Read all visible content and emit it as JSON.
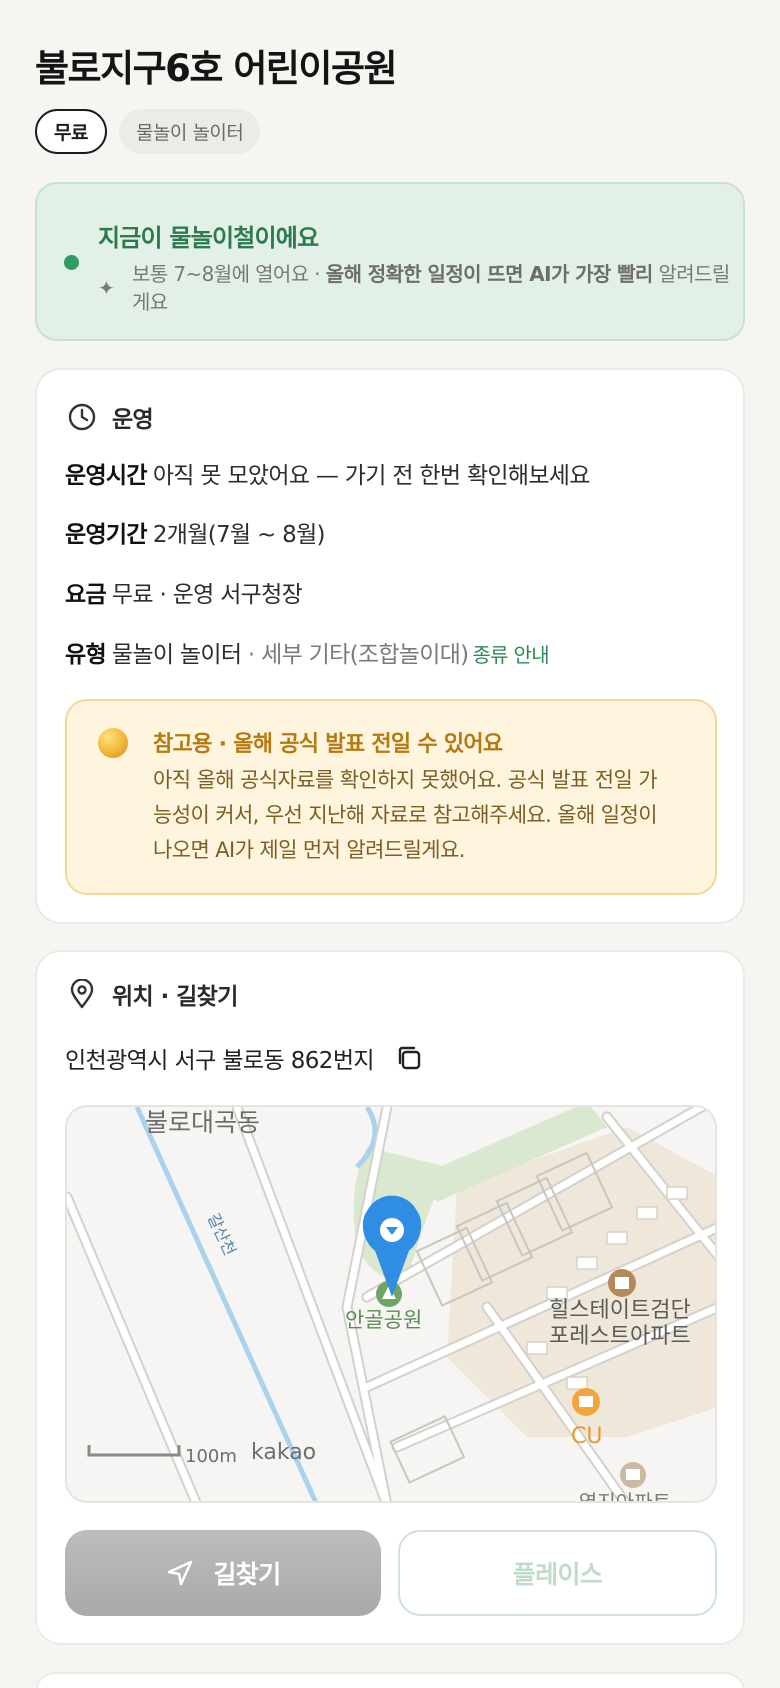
{
  "page": {
    "title": "불로지구6호 어린이공원",
    "chips": [
      "무료",
      "물놀이 놀이터"
    ]
  },
  "season": {
    "headline": "지금이 물놀이철이에요",
    "sub_plain": "보통 7~8월에 열어요 · ",
    "sub_bold": "올해 정확한 일정이 뜨면 AI가 가장 빨리",
    "sub_tail": "알려드릴게요",
    "accent": "#2d9c65"
  },
  "operation": {
    "section_title": "운영",
    "section_icon": "clock-icon",
    "hours_label": "운영시간",
    "hours_value": "아직 못 모았어요 — 가기 전 한번 확인해보세요",
    "period_label": "운영기간",
    "period_value": "2개월(7월 ~ 8월)",
    "fee_label": "요금",
    "fee_value": "무료 · 운영 서구청장",
    "type_label": "유형",
    "type_value": "물놀이 놀이터",
    "type_detail": " · 세부 기타(조합놀이대)",
    "type_link": "종류 안내",
    "notice": {
      "title": "참고용 · 올해 공식 발표 전일 수 있어요",
      "body": "아직 올해 공식자료를 확인하지 못했어요. 공식 발표 전일 가능성이 커서, 우선 지난해 자료로 참고해주세요. 올해 일정이 나오면 AI가 제일 먼저 알려드릴게요.",
      "icon": "coin-icon"
    }
  },
  "location": {
    "section_title": "위치 · 길찾기",
    "section_icon": "map-pin-icon",
    "address": "인천광역시 서구 불로동 862번지",
    "copy_icon": "copy-icon",
    "map": {
      "district_label": "불로대곡동",
      "stream_label": "갈산천",
      "park_label": "안골공원",
      "apt_label_1": "힐스테이트검단",
      "apt_label_2": "포레스트아파트",
      "store_label": "CU",
      "apt_label_3": "엳지아파트",
      "scale_label": "100m",
      "provider": "kakao"
    },
    "nav_button": "길찾기",
    "place_button": "플레이스"
  }
}
